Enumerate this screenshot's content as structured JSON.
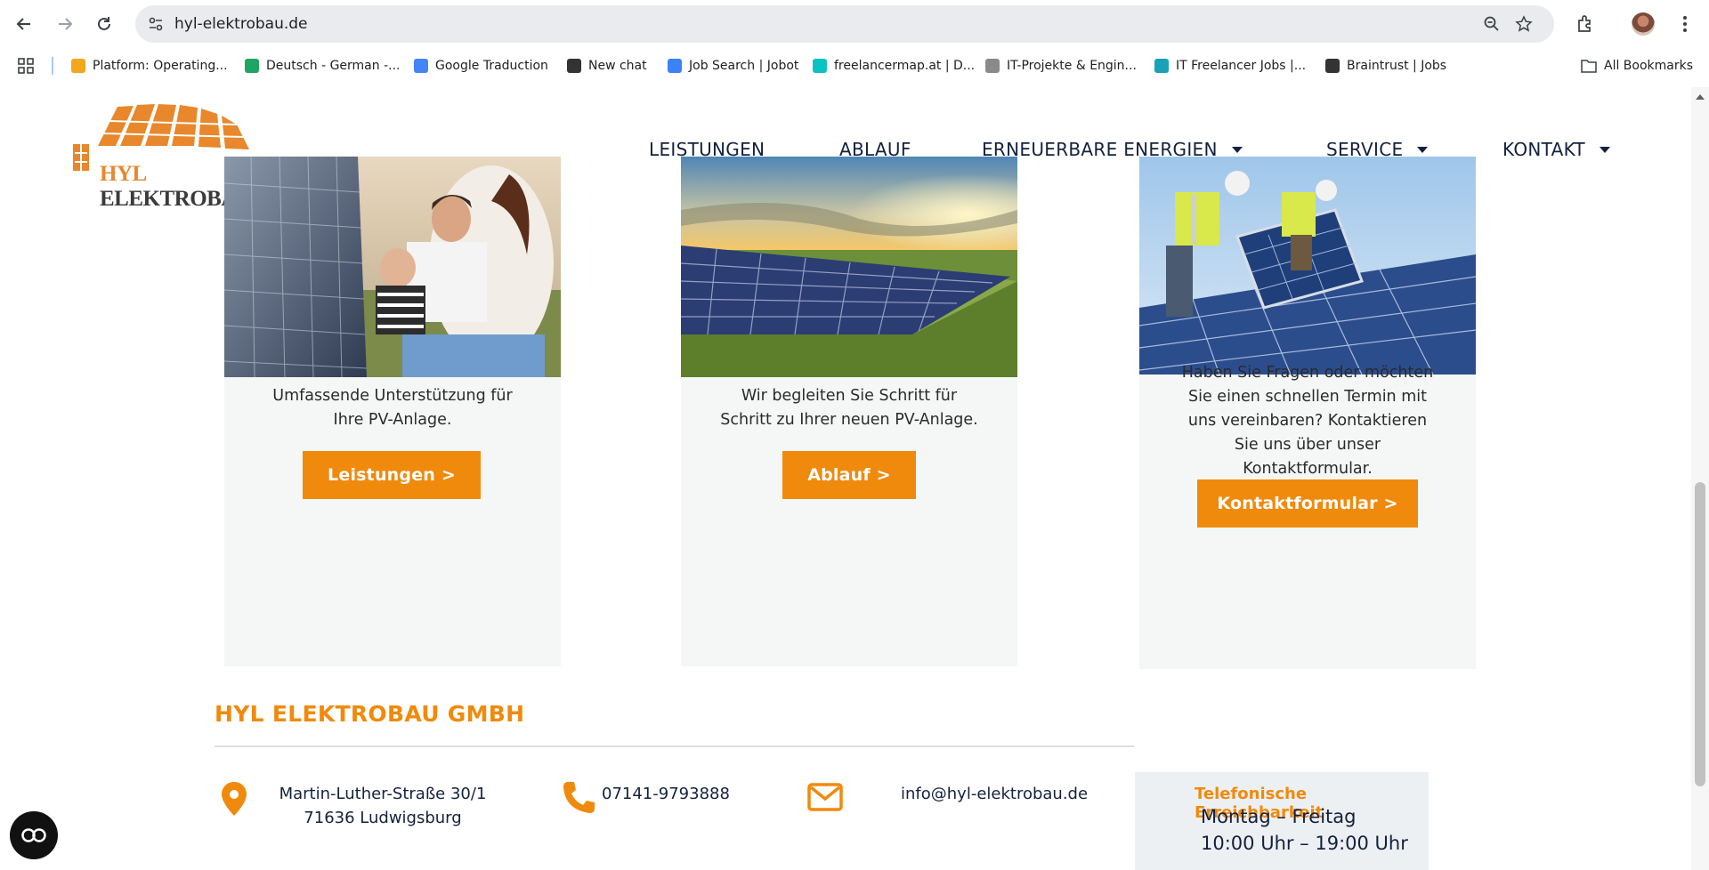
{
  "browser": {
    "url": "hyl-elektrobau.de",
    "bookmarks": [
      {
        "label": "Platform: Operating...",
        "icon": "package-icon",
        "color": "#f2a81d"
      },
      {
        "label": "Deutsch - German -...",
        "icon": "google-drive-icon",
        "color": "#1fa463"
      },
      {
        "label": "Google Traduction",
        "icon": "google-translate-icon",
        "color": "#4285f4"
      },
      {
        "label": "New chat",
        "icon": "openai-icon",
        "color": "#333333"
      },
      {
        "label": "Job Search | Jobot",
        "icon": "jobot-icon",
        "color": "#3b82f6"
      },
      {
        "label": "freelancermap.at | D...",
        "icon": "freelancermap-icon",
        "color": "#0bc2c2"
      },
      {
        "label": "IT-Projekte & Engin...",
        "icon": "it-projects-icon",
        "color": "#8a8a8a"
      },
      {
        "label": "IT Freelancer Jobs |...",
        "icon": "it-freelancer-icon",
        "color": "#17a2b8"
      },
      {
        "label": "Braintrust | Jobs",
        "icon": "braintrust-icon",
        "color": "#333333"
      }
    ],
    "all_bookmarks": "All Bookmarks"
  },
  "header": {
    "logo_hyl": "HYL",
    "logo_rest": " ELEKTROBAU",
    "logo_reg": "®",
    "nav": {
      "leistungen": "LEISTUNGEN",
      "ablauf": "ABLAUF",
      "erneuerbare": "ERNEUERBARE ENERGIEN",
      "service": "SERVICE",
      "kontakt": "KONTAKT"
    }
  },
  "cards": [
    {
      "text_1": "Umfassende Unterstützung für",
      "text_2": "Ihre PV-Anlage.",
      "button": "Leistungen >"
    },
    {
      "text_1": "Wir begleiten Sie Schritt für",
      "text_2": "Schritt zu Ihrer neuen PV-Anlage.",
      "button": "Ablauf >"
    },
    {
      "text_1": "Haben Sie Fragen oder möchten",
      "text_2": "Sie einen schnellen Termin mit",
      "text_3": "uns vereinbaren? Kontaktieren",
      "text_4": "Sie uns über unser",
      "text_5": "Kontaktformular.",
      "button": "Kontaktformular >"
    }
  ],
  "footer": {
    "company": "HYL ELEKTROBAU GMBH",
    "address_1": "Martin-Luther-Straße 30/1",
    "address_2": "71636 Ludwigsburg",
    "phone": "07141-9793888",
    "email": "info@hyl-elektrobau.de",
    "hours_title": "Telefonische Erreichbarkeit",
    "hours_days": "Montag – Freitag",
    "hours_time": "10:00 Uhr – 19:00 Uhr"
  },
  "colors": {
    "accent": "#f08a0c",
    "navy": "#14213d"
  }
}
